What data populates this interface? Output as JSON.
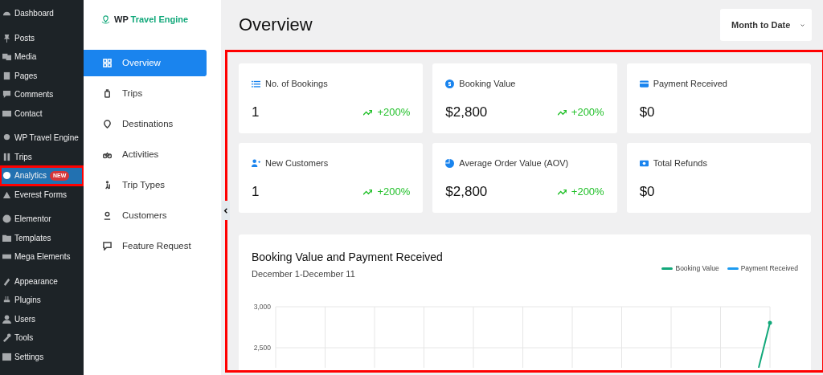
{
  "wp_sidebar": {
    "groups": [
      {
        "items": [
          {
            "label": "Dashboard",
            "selected": false
          }
        ]
      },
      {
        "items": [
          {
            "label": "Posts",
            "selected": false
          },
          {
            "label": "Media",
            "selected": false
          },
          {
            "label": "Pages",
            "selected": false
          },
          {
            "label": "Comments",
            "selected": false
          },
          {
            "label": "Contact",
            "selected": false
          }
        ]
      },
      {
        "items": [
          {
            "label": "WP Travel Engine",
            "selected": false
          },
          {
            "label": "Trips",
            "selected": false
          },
          {
            "label": "Analytics",
            "selected": true,
            "badge": "NEW",
            "highlighted": true
          },
          {
            "label": "Everest Forms",
            "selected": false
          }
        ]
      },
      {
        "items": [
          {
            "label": "Elementor",
            "selected": false
          },
          {
            "label": "Templates",
            "selected": false
          },
          {
            "label": "Mega Elements",
            "selected": false
          }
        ]
      },
      {
        "items": [
          {
            "label": "Appearance",
            "selected": false
          },
          {
            "label": "Plugins",
            "selected": false
          },
          {
            "label": "Users",
            "selected": false
          },
          {
            "label": "Tools",
            "selected": false
          },
          {
            "label": "Settings",
            "selected": false
          }
        ]
      }
    ]
  },
  "plugin_nav": {
    "logo": {
      "prefix": "WP",
      "name": "Travel Engine"
    },
    "items": [
      {
        "label": "Overview",
        "selected": true
      },
      {
        "label": "Trips",
        "selected": false
      },
      {
        "label": "Destinations",
        "selected": false
      },
      {
        "label": "Activities",
        "selected": false
      },
      {
        "label": "Trip Types",
        "selected": false
      },
      {
        "label": "Customers",
        "selected": false
      },
      {
        "label": "Feature Request",
        "selected": false
      }
    ]
  },
  "main": {
    "title": "Overview",
    "period_dropdown": {
      "value": "Month to Date"
    },
    "highlighted": true,
    "stats": [
      {
        "label": "No. of Bookings",
        "value": "1",
        "trend": "+200%"
      },
      {
        "label": "Booking Value",
        "value": "$2,800",
        "trend": "+200%"
      },
      {
        "label": "Payment Received",
        "value": "$0"
      },
      {
        "label": "New Customers",
        "value": "1",
        "trend": "+200%"
      },
      {
        "label": "Average Order Value (AOV)",
        "value": "$2,800",
        "trend": "+200%"
      },
      {
        "label": "Total Refunds",
        "value": "$0"
      }
    ],
    "chart": {
      "title": "Booking Value and Payment Received",
      "subtitle": "December 1-December 11",
      "y_axis_labels": [
        "3,000",
        "2,500"
      ],
      "legend": [
        {
          "name": "Booking Value",
          "color": "#12a87a"
        },
        {
          "name": "Payment Received",
          "color": "#1e9bf0"
        }
      ]
    }
  }
}
